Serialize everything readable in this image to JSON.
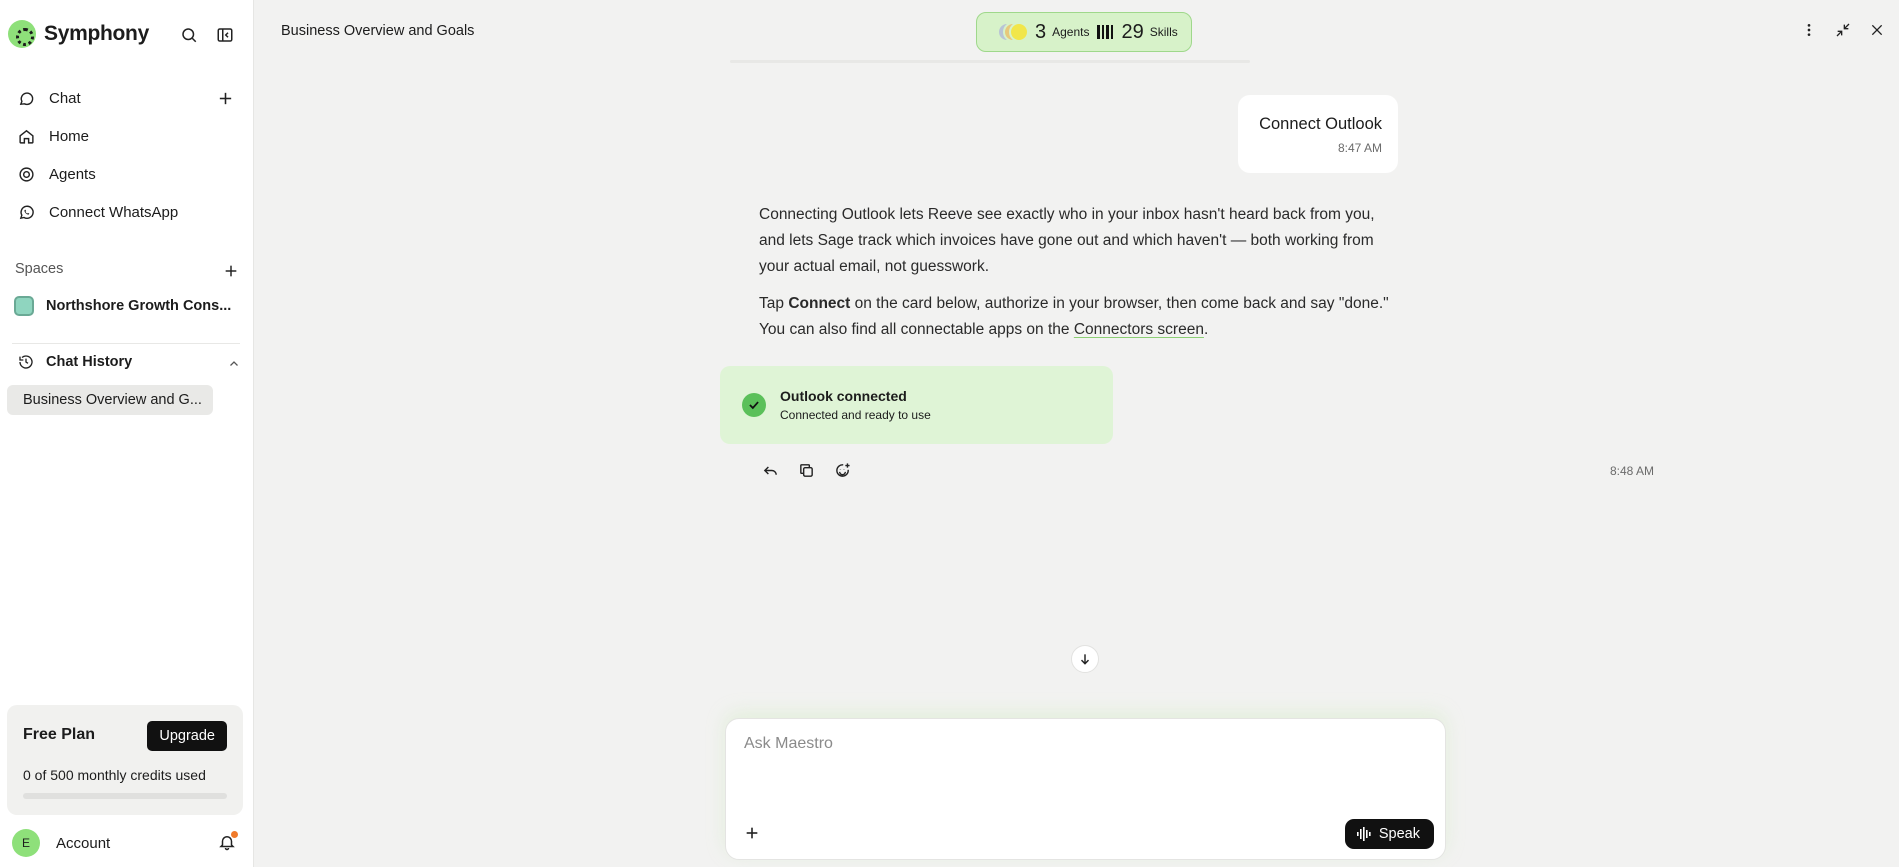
{
  "app": {
    "name": "Symphony"
  },
  "sidebar": {
    "nav": [
      {
        "label": "Chat",
        "icon": "chat-bubble-icon"
      },
      {
        "label": "Home",
        "icon": "home-icon"
      },
      {
        "label": "Agents",
        "icon": "target-icon"
      },
      {
        "label": "Connect WhatsApp",
        "icon": "whatsapp-icon"
      }
    ],
    "spaces_label": "Spaces",
    "space_name": "Northshore Growth Cons...",
    "history_label": "Chat History",
    "history_items": [
      "Business Overview and G..."
    ],
    "plan": {
      "title": "Free Plan",
      "upgrade_label": "Upgrade",
      "credits_text": "0 of 500 monthly credits used",
      "credits_used_fraction": 0
    },
    "account": {
      "initial": "E",
      "label": "Account"
    }
  },
  "header": {
    "title": "Business Overview and Goals",
    "agents_count": "3",
    "agents_label": "Agents",
    "skills_count": "29",
    "skills_label": "Skills"
  },
  "chat": {
    "user_message": {
      "text": "Connect Outlook",
      "time": "8:47 AM"
    },
    "assistant": {
      "paragraph1": "Connecting Outlook lets Reeve see exactly who in your inbox hasn't heard back from you, and lets Sage track which invoices have gone out and which haven't — both working from your actual email, not guesswork.",
      "p2_before": "Tap ",
      "p2_bold": "Connect",
      "p2_middle": " on the card below, authorize in your browser, then come back and say \"done.\" You can also find all connectable apps on the ",
      "p2_link": "Connectors screen",
      "p2_after": ".",
      "time": "8:48 AM"
    },
    "card": {
      "title": "Outlook connected",
      "subtitle": "Connected and ready to use"
    }
  },
  "composer": {
    "placeholder": "Ask Maestro",
    "value": "",
    "speak_label": "Speak"
  },
  "colors": {
    "accent": "#8ee07a",
    "card_bg": "#dff4d6",
    "pill_bg": "#d7f2c9",
    "check": "#5bc05a"
  }
}
